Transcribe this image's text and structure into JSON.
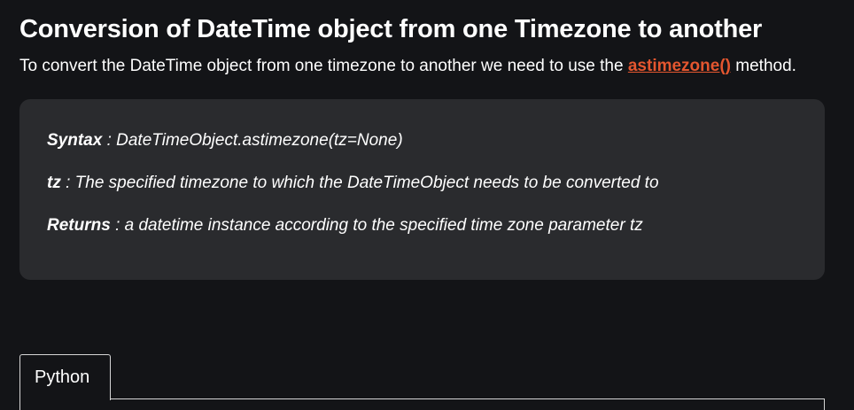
{
  "section": {
    "title": "Conversion of DateTime object from one Timezone to another",
    "intro_before": "To convert the DateTime object from one timezone to another we need to use the ",
    "method_link": "astimezone()",
    "intro_after": " method."
  },
  "syntax": {
    "syntax_label": "Syntax",
    "syntax_text": " : DateTimeObject.astimezone(tz=None)",
    "tz_label": "tz",
    "tz_text": " : The specified timezone to which the DateTimeObject needs to be converted to",
    "returns_label": "Returns",
    "returns_text": " :  a datetime instance according to the specified time zone parameter tz"
  },
  "code_tabs": {
    "active_tab": "Python"
  },
  "colors": {
    "background": "#131417",
    "box": "#2a2b2e",
    "link": "#e4562f"
  }
}
